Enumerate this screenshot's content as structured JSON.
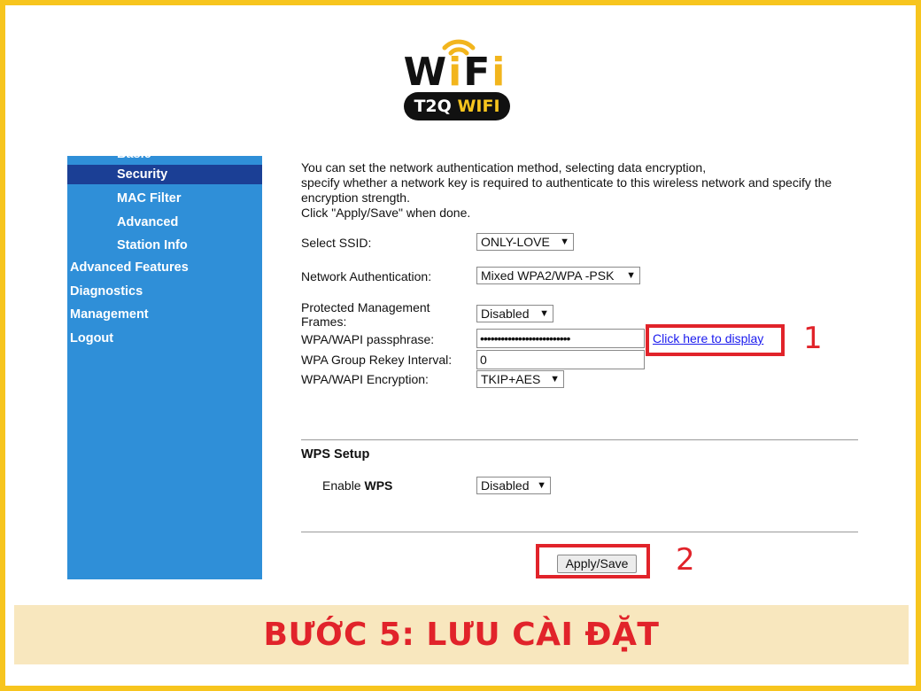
{
  "logo": {
    "wordmark_parts": [
      "W",
      "i",
      "F",
      "i"
    ],
    "badge_part1": "T2Q",
    "badge_part2": "WIFI"
  },
  "sidebar": {
    "items": [
      {
        "label": "Basic"
      },
      {
        "label": "Security",
        "active": true
      },
      {
        "label": "MAC Filter"
      },
      {
        "label": "Advanced"
      },
      {
        "label": "Station Info"
      },
      {
        "label": "Advanced Features"
      },
      {
        "label": "Diagnostics"
      },
      {
        "label": "Management"
      },
      {
        "label": "Logout"
      }
    ]
  },
  "content": {
    "intro_lines": [
      "You can set the network authentication method, selecting data encryption,",
      "specify whether a network key is required to authenticate to this wireless network and specify the",
      "encryption strength.",
      "Click \"Apply/Save\" when done."
    ],
    "ssid": {
      "label": "Select SSID:",
      "value": "ONLY-LOVE"
    },
    "auth": {
      "label": "Network Authentication:",
      "value": "Mixed WPA2/WPA -PSK"
    },
    "pmf": {
      "label_line1": "Protected Management",
      "label_line2": "Frames:",
      "value": "Disabled"
    },
    "passphrase": {
      "label": "WPA/WAPI passphrase:",
      "value": "••••••••••••••••••••••••••",
      "link": "Click here to display"
    },
    "rekey": {
      "label": "WPA Group Rekey Interval:",
      "value": "0"
    },
    "encryption": {
      "label": "WPA/WAPI Encryption:",
      "value": "TKIP+AES"
    },
    "wps": {
      "title": "WPS Setup",
      "enable_label_plain": "Enable ",
      "enable_label_bold": "WPS",
      "value": "Disabled"
    },
    "apply_label": "Apply/Save",
    "dropdown_arrow": "▼"
  },
  "annotations": {
    "marker1": "1",
    "marker2": "2",
    "color": "#e1232a"
  },
  "banner": {
    "text": "BƯỚC 5: LƯU CÀI ĐẶT"
  },
  "colors": {
    "border": "#f7c51e",
    "sidebar": "#2f8fd8",
    "sidebar_active": "#1b3f95",
    "banner_bg": "#f8e7be",
    "link": "#1a1aee"
  }
}
